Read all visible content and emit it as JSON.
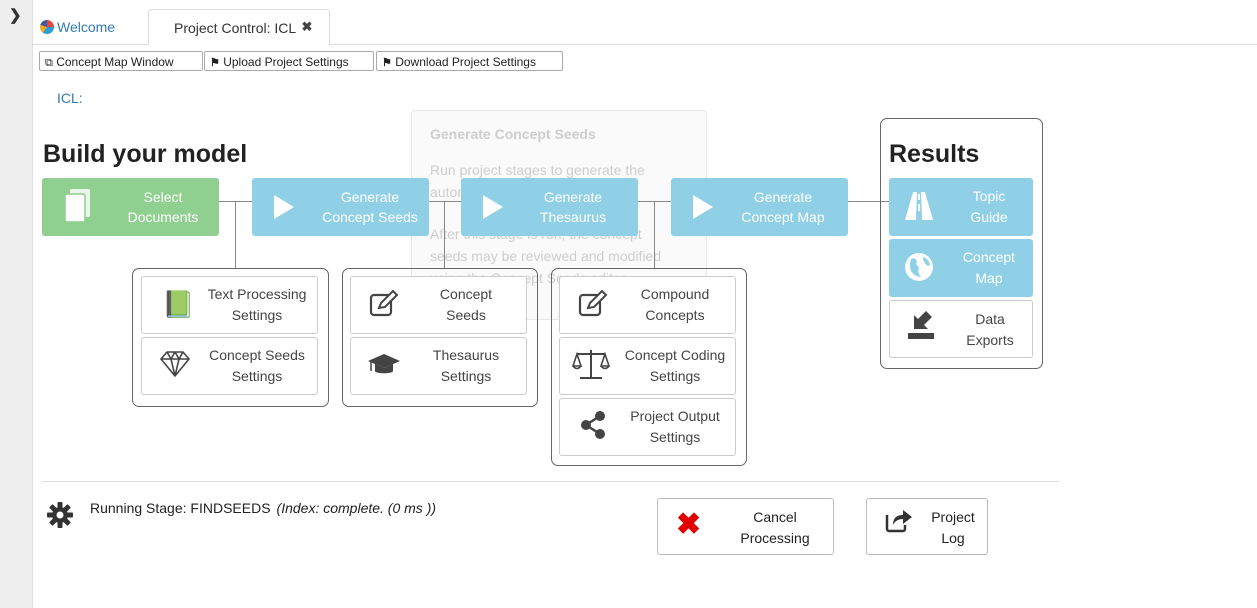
{
  "tabs": [
    {
      "label": "Welcome"
    },
    {
      "label": "Project Control: ICL"
    }
  ],
  "toolbar": {
    "concept_map_window": "Concept Map Window",
    "upload_settings": "Upload Project Settings",
    "download_settings": "Download Project Settings"
  },
  "project_name": "ICL:",
  "build_heading": "Build your model",
  "results_heading": "Results",
  "stages": [
    {
      "line1": "Select",
      "line2": "Documents"
    },
    {
      "line1": "Generate",
      "line2": "Concept Seeds"
    },
    {
      "line1": "Generate",
      "line2": "Thesaurus"
    },
    {
      "line1": "Generate",
      "line2": "Concept Map"
    }
  ],
  "settings": {
    "text_processing": {
      "line1": "Text Processing",
      "line2": "Settings"
    },
    "concept_seeds_settings": {
      "line1": "Concept Seeds",
      "line2": "Settings"
    },
    "concept_seeds": {
      "line1": "Concept",
      "line2": "Seeds"
    },
    "thesaurus_settings": {
      "line1": "Thesaurus",
      "line2": "Settings"
    },
    "compound_concepts": {
      "line1": "Compound",
      "line2": "Concepts"
    },
    "concept_coding": {
      "line1": "Concept Coding",
      "line2": "Settings"
    },
    "project_output": {
      "line1": "Project Output",
      "line2": "Settings"
    }
  },
  "results": [
    {
      "line1": "Topic",
      "line2": "Guide"
    },
    {
      "line1": "Concept",
      "line2": "Map"
    },
    {
      "line1": "Data",
      "line2": "Exports"
    }
  ],
  "tooltip": {
    "title": "Generate Concept Seeds",
    "line1": "Run project stages to generate the",
    "line2": "automatic concept seeds.",
    "line3": "After this stage is run, the concept",
    "line4": "seeds may be reviewed and modified",
    "line5": "using the Concept Seeds editor."
  },
  "status": {
    "text": "Running Stage: FINDSEEDS",
    "detail": "(Index: complete. (0 ms ))"
  },
  "cancel": {
    "line1": "Cancel",
    "line2": "Processing"
  },
  "log": {
    "line1": "Project",
    "line2": "Log"
  },
  "colors": {
    "green": "#8fcf8f",
    "blue": "#8fd0e6",
    "link": "#337ab7",
    "cancel_red": "#e00000"
  }
}
